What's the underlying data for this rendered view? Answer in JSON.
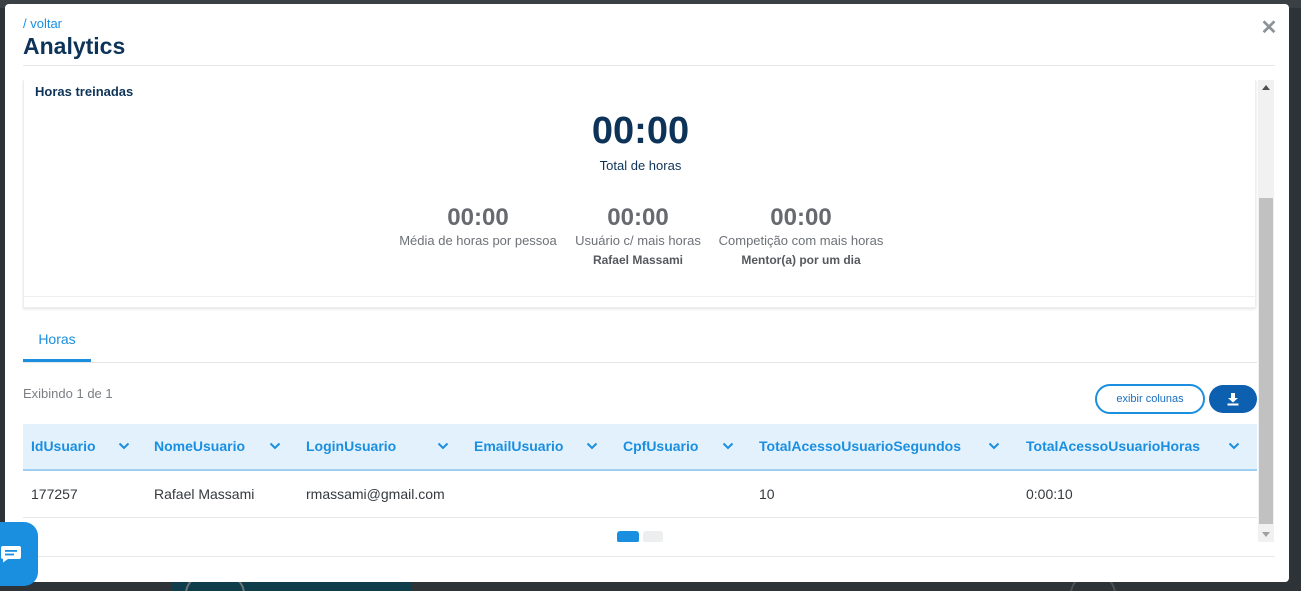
{
  "header": {
    "back_link": "/ voltar",
    "title": "Analytics"
  },
  "summary_card": {
    "title": "Horas treinadas",
    "total_value": "00:00",
    "total_label": "Total de horas",
    "stats": [
      {
        "value": "00:00",
        "label": "Média de horas por pessoa",
        "sub": ""
      },
      {
        "value": "00:00",
        "label": "Usuário c/ mais horas",
        "sub": "Rafael Massami"
      },
      {
        "value": "00:00",
        "label": "Competição com mais horas",
        "sub": "Mentor(a) por um dia"
      }
    ]
  },
  "tabs": [
    {
      "label": "Horas",
      "active": true
    }
  ],
  "table_toolbar": {
    "showing_text": "Exibindo 1 de 1",
    "columns_button": "exibir colunas",
    "download_icon": "download-icon"
  },
  "table": {
    "columns": [
      "IdUsuario",
      "NomeUsuario",
      "LoginUsuario",
      "EmailUsuario",
      "CpfUsuario",
      "TotalAcessoUsuarioSegundos",
      "TotalAcessoUsuarioHoras"
    ],
    "rows": [
      [
        "177257",
        "Rafael Massami",
        "rmassami@gmail.com",
        "",
        "",
        "10",
        "0:00:10"
      ]
    ]
  },
  "pagination": {
    "current_page": 1,
    "total_pages": 2
  },
  "colors": {
    "accent": "#1a8fe0",
    "title": "#0d3458",
    "download_button": "#0d5fb0",
    "table_header_bg": "#e3f1fd"
  },
  "icons": {
    "close": "close-icon",
    "chevron": "chevron-down-icon",
    "chat": "chat-icon"
  }
}
